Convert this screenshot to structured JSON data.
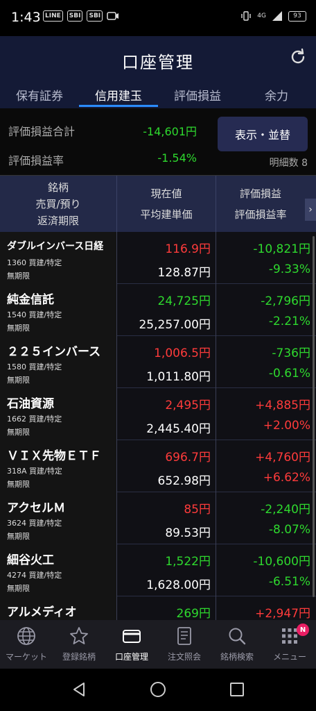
{
  "status_bar": {
    "time": "1:43",
    "notif_icons": [
      "LINE",
      "SBI",
      "SBI"
    ],
    "network": "4G",
    "battery": "93"
  },
  "header": {
    "title": "口座管理",
    "tabs": [
      {
        "label": "保有証券"
      },
      {
        "label": "信用建玉"
      },
      {
        "label": "評価損益"
      },
      {
        "label": "余力"
      }
    ],
    "active_tab": 1
  },
  "summary": {
    "total_label": "評価損益合計",
    "total_value": "-14,601円",
    "rate_label": "評価損益率",
    "rate_value": "-1.54%",
    "display_button": "表示・並替",
    "detail_count": "明細数 8"
  },
  "columns": {
    "col1": [
      "銘柄",
      "売買/預り",
      "返済期限"
    ],
    "col2": [
      "現在値",
      "平均建単価"
    ],
    "col3": [
      "評価損益",
      "評価損益率"
    ]
  },
  "rows": [
    {
      "name": "ダブルインバース日経",
      "code": "1360 買建/特定",
      "term": "無期限",
      "price": "116.9円",
      "price_color": "red",
      "avg": "128.87円",
      "pl": "-10,821円",
      "plr": "-9.33%",
      "pl_color": "green"
    },
    {
      "name": "純金信託",
      "code": "1540 買建/特定",
      "term": "無期限",
      "price": "24,725円",
      "price_color": "green",
      "avg": "25,257.00円",
      "pl": "-2,796円",
      "plr": "-2.21%",
      "pl_color": "green"
    },
    {
      "name": "２２５インバース",
      "code": "1580 買建/特定",
      "term": "無期限",
      "price": "1,006.5円",
      "price_color": "red",
      "avg": "1,011.80円",
      "pl": "-736円",
      "plr": "-0.61%",
      "pl_color": "green"
    },
    {
      "name": "石油資源",
      "code": "1662 買建/特定",
      "term": "無期限",
      "price": "2,495円",
      "price_color": "red",
      "avg": "2,445.40円",
      "pl": "+4,885円",
      "plr": "+2.00%",
      "pl_color": "red"
    },
    {
      "name": "ＶＩＸ先物ＥＴＦ",
      "code": "318A 買建/特定",
      "term": "無期限",
      "price": "696.7円",
      "price_color": "red",
      "avg": "652.98円",
      "pl": "+4,760円",
      "plr": "+6.62%",
      "pl_color": "red"
    },
    {
      "name": "アクセルＭ",
      "code": "3624 買建/特定",
      "term": "無期限",
      "price": "85円",
      "price_color": "red",
      "avg": "89.53円",
      "pl": "-2,240円",
      "plr": "-8.07%",
      "pl_color": "green"
    },
    {
      "name": "細谷火工",
      "code": "4274 買建/特定",
      "term": "無期限",
      "price": "1,522円",
      "price_color": "green",
      "avg": "1,628.00円",
      "pl": "-10,600円",
      "plr": "-6.51%",
      "pl_color": "green"
    },
    {
      "name": "アルメディオ",
      "code": "",
      "term": "",
      "price": "269円",
      "price_color": "green",
      "avg": "",
      "pl": "+2,947円",
      "plr": "",
      "pl_color": "red"
    }
  ],
  "bottom_nav": [
    {
      "label": "マーケット",
      "icon": "globe-icon"
    },
    {
      "label": "登録銘柄",
      "icon": "star-icon"
    },
    {
      "label": "口座管理",
      "icon": "card-icon"
    },
    {
      "label": "注文照会",
      "icon": "document-icon"
    },
    {
      "label": "銘柄検索",
      "icon": "search-icon"
    },
    {
      "label": "メニュー",
      "icon": "grid-icon",
      "badge": "N"
    }
  ],
  "active_nav": 2,
  "colors": {
    "red": "#ff3b3b",
    "green": "#2ed92e",
    "header_bg": "#141a36",
    "accent": "#2b8cff"
  }
}
